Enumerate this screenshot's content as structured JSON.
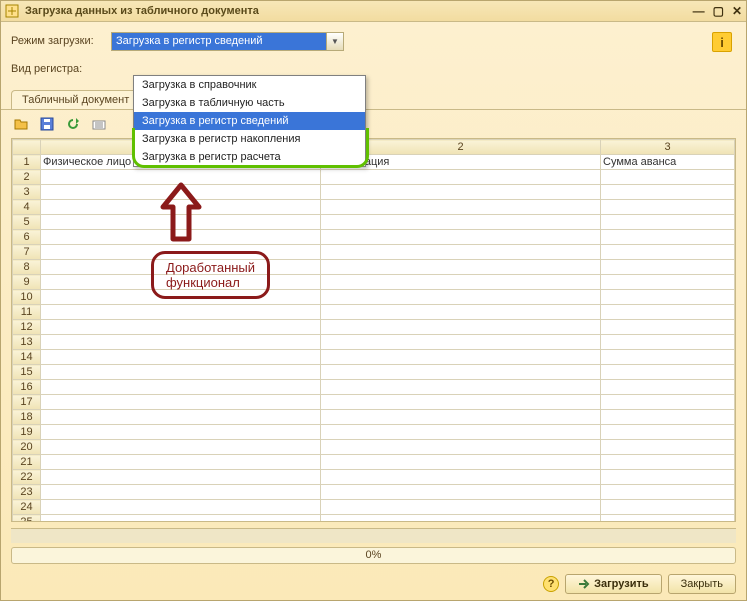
{
  "window": {
    "title": "Загрузка данных из табличного документа"
  },
  "form": {
    "mode_label": "Режим загрузки:",
    "mode_value": "Загрузка в регистр сведений",
    "register_label": "Вид регистра:"
  },
  "dropdown": {
    "items": [
      "Загрузка в справочник",
      "Загрузка в табличную часть",
      "Загрузка в регистр сведений",
      "Загрузка в регистр накопления",
      "Загрузка в регистр расчета"
    ],
    "highlighted_index": 2
  },
  "tabs": {
    "active": "Табличный документ"
  },
  "grid": {
    "col_numbers": [
      "1",
      "2",
      "3"
    ],
    "subheaders": [
      "Физическое лицо",
      "Организация",
      "Сумма аванса"
    ],
    "rows": 27
  },
  "progress": {
    "text": "0%"
  },
  "buttons": {
    "load": "Загрузить",
    "close": "Закрыть"
  },
  "annotation": {
    "line1": "Доработанный",
    "line2": "функционал"
  }
}
